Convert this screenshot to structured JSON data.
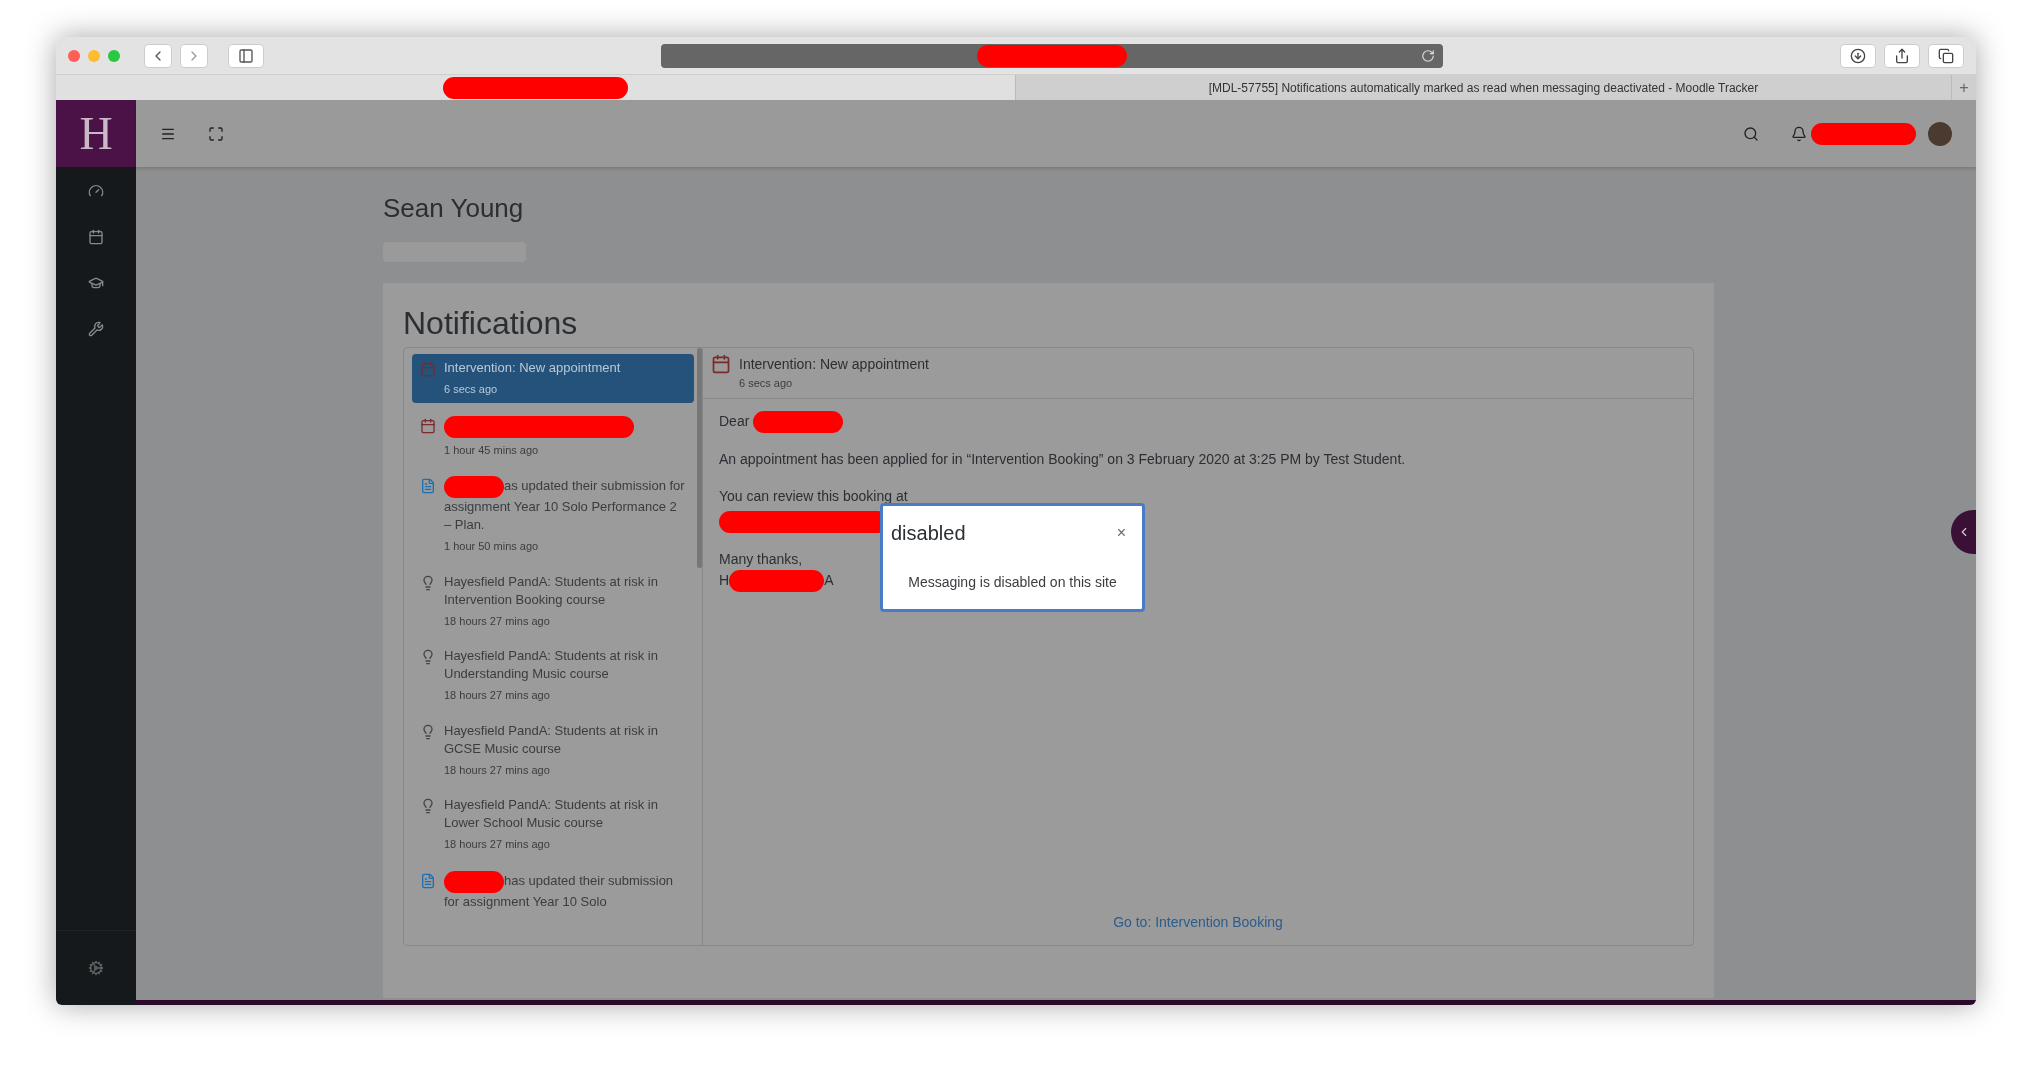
{
  "browser": {
    "address_redacted": true,
    "active_tab_redacted": true,
    "tabs": [
      {
        "title": "[MDL-57755] Notifications automatically marked as read when messaging deactivated - Moodle Tracker",
        "selected": false
      }
    ],
    "new_tab": "+"
  },
  "header": {
    "logo": "H",
    "user_redacted": true
  },
  "profile": {
    "name": "Sean Young"
  },
  "page_title": "Notifications",
  "notifications": [
    {
      "kind": "calendar",
      "title": "Intervention: New appointment",
      "time": "6 secs ago",
      "selected": true,
      "redacted": false
    },
    {
      "kind": "calendar",
      "time": "1 hour 45 mins ago",
      "selected": false,
      "redacted": true
    },
    {
      "kind": "assignment",
      "title": "as updated their submission for assignment Year 10 Solo Performance 2 – Plan.",
      "time": "1 hour 50 mins ago",
      "selected": false,
      "redacted": true
    },
    {
      "kind": "lightbulb",
      "title": "Hayesfield PandA: Students at risk in Intervention Booking course",
      "time": "18 hours 27 mins ago",
      "selected": false,
      "redacted": false
    },
    {
      "kind": "lightbulb",
      "title": "Hayesfield PandA: Students at risk in Understanding Music course",
      "time": "18 hours 27 mins ago",
      "selected": false,
      "redacted": false
    },
    {
      "kind": "lightbulb",
      "title": "Hayesfield PandA: Students at risk in GCSE Music course",
      "time": "18 hours 27 mins ago",
      "selected": false,
      "redacted": false
    },
    {
      "kind": "lightbulb",
      "title": "Hayesfield PandA: Students at risk in Lower School Music course",
      "time": "18 hours 27 mins ago",
      "selected": false,
      "redacted": false
    },
    {
      "kind": "assignment",
      "title": "has updated their submission for assignment Year 10 Solo",
      "selected": false,
      "redacted": true
    }
  ],
  "detail": {
    "title": "Intervention: New appointment",
    "time": "6 secs ago",
    "greeting": "Dear",
    "body": "An appointment has been applied for in “Intervention Booking” on 3 February 2020 at 3:25 PM by Test Student.",
    "review": "You can review this booking at",
    "sign_off": "Many thanks,",
    "signature_start": "H",
    "signature_end": "A",
    "footer_link": "Go to: Intervention Booking"
  },
  "dialog": {
    "title": "disabled",
    "close": "×",
    "message": "Messaging is disabled on this site"
  }
}
